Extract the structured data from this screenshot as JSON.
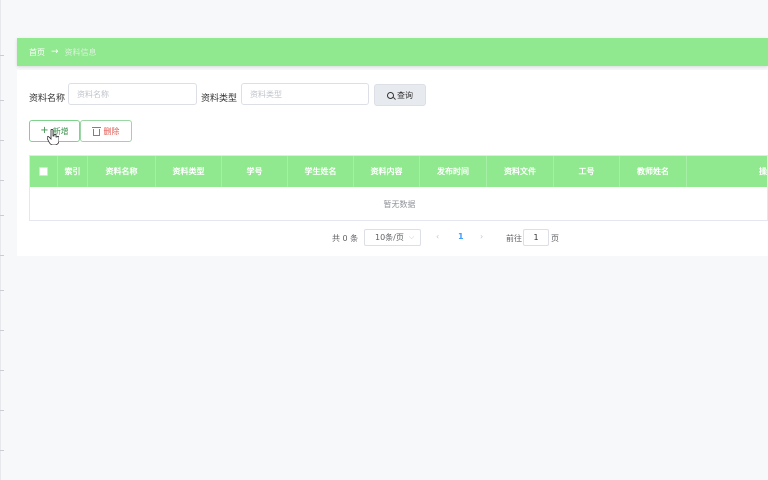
{
  "breadcrumb": {
    "home": "首页",
    "separator": "→",
    "current": "资料信息"
  },
  "search": {
    "name_label": "资料名称",
    "name_placeholder": "资料名称",
    "name_value": "",
    "type_label": "资料类型",
    "type_placeholder": "资料类型",
    "type_value": "",
    "query_label": "查询"
  },
  "toolbar": {
    "add_label": "新增",
    "delete_label": "删除"
  },
  "table": {
    "columns": [
      "索引",
      "资料名称",
      "资料类型",
      "学号",
      "学生姓名",
      "资料内容",
      "发布时间",
      "资料文件",
      "工号",
      "教师姓名",
      "操"
    ],
    "empty_text": "暂无数据"
  },
  "pagination": {
    "total": "共 0 条",
    "page_size": "10条/页",
    "current_page": "1",
    "goto_label": "前往",
    "goto_value": "1",
    "page_suffix": "页"
  },
  "colors": {
    "header_green": "#90e88f",
    "accent_green": "#3d8f4c",
    "danger": "#e0584f"
  }
}
